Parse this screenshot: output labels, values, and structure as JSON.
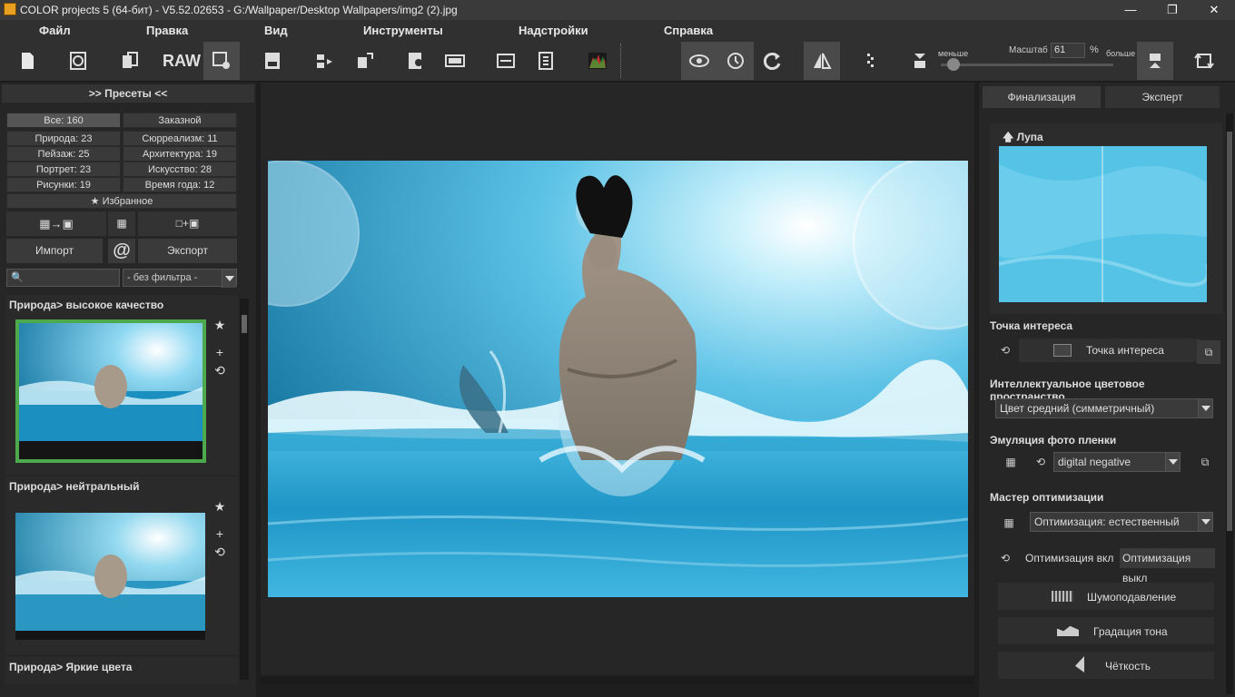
{
  "window": {
    "title": "COLOR projects 5 (64-бит) - V5.52.02653 - G:/Wallpaper/Desktop Wallpapers/img2 (2).jpg",
    "min": "—",
    "max": "❐",
    "close": "✕"
  },
  "menu": [
    "Файл",
    "Правка",
    "Вид",
    "Инструменты",
    "Надстройки",
    "Справка"
  ],
  "toolbar": {
    "raw": "RAW",
    "zoom_less": "меньше",
    "zoom_more": "больше",
    "zoom_label": "Масштаб",
    "zoom_value": "61",
    "zoom_unit": "%"
  },
  "presets": {
    "header": ">> Пресеты <<",
    "cats": [
      {
        "l": "Все: 160",
        "r": "Заказной"
      },
      {
        "l": "Природа: 23",
        "r": "Сюрреализм: 11"
      },
      {
        "l": "Пейзаж: 25",
        "r": "Архитектура: 19"
      },
      {
        "l": "Портрет: 23",
        "r": "Искусство: 28"
      },
      {
        "l": "Рисунки: 19",
        "r": "Время года: 12"
      }
    ],
    "favorites": "Избранное",
    "import": "Импорт",
    "export": "Экспорт",
    "at": "@",
    "filter": "- без фильтра -",
    "items": [
      "Природа> высокое качество",
      "Природа> нейтральный",
      "Природа> Яркие цвета"
    ]
  },
  "right": {
    "tab_final": "Финализация",
    "tab_expert": "Эксперт",
    "loupe": "Лупа",
    "poi_header": "Точка интереса",
    "poi_button": "Точка интереса",
    "space_header": "Интеллектуальное цветовое пространство",
    "space_value": "Цвет средний (симметричный)",
    "film_header": "Эмуляция фото пленки",
    "film_value": "digital negative",
    "opt_header": "Мастер оптимизации",
    "opt_value": "Оптимизация: естественный",
    "opt_on": "Оптимизация вкл",
    "opt_off": "Оптимизация выкл",
    "noise": "Шумоподавление",
    "tone": "Градация тона",
    "sharp": "Чёткость"
  }
}
